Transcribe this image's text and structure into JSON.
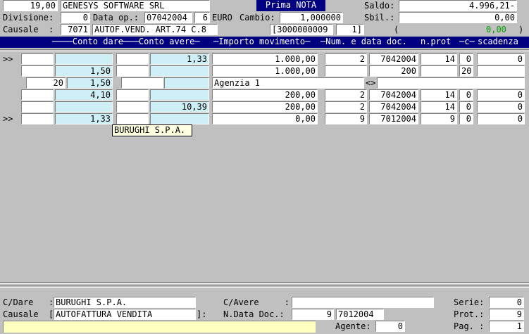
{
  "header": {
    "top_value": "19,00",
    "company": "GENESYS SOFTWARE SRL",
    "title": "Prima NOTA",
    "saldo_label": "Saldo:",
    "saldo_value": "4.996,21-",
    "divisione_label": "Divisione:",
    "divisione_value": "0",
    "data_op_label": "Data op.:",
    "data_op_value": "07042004",
    "data_op_extra": "6",
    "euro_label": "EURO",
    "cambio_label": "Cambio:",
    "cambio_value": "1,000000",
    "sbil_label": "Sbil.:",
    "sbil_value": "0,00",
    "causale_label": "Causale  :",
    "causale_code": "7071",
    "causale_desc": "AUTOF.VEND. ART.74 C.8",
    "doc_number": "[3000000009",
    "doc_extra": "1]",
    "paren_open": "(",
    "green_value": "0,00",
    "paren_close": ")"
  },
  "columns": {
    "conto_dare": "Conto dare",
    "conto_avere": "Conto avere",
    "importo": "Importo movimento",
    "num_data": "Num. e data doc.",
    "n_prot": "n.prot",
    "c": "c",
    "scadenza": "scadenza"
  },
  "rows": [
    {
      "marker": ">>",
      "dare_code": "",
      "dare_val": "",
      "avere_code": "",
      "avere_val": "1,33",
      "importo": "1.000,00",
      "num": "2",
      "data": "7042004",
      "prot": "14",
      "c": "0",
      "scad": "0"
    },
    {
      "marker": "",
      "dare_code": "",
      "dare_val": "1,50",
      "avere_code": "",
      "avere_val": "",
      "importo": "1.000,00",
      "num": "",
      "data": "200",
      "prot": "",
      "c": "20",
      "scad": ""
    },
    {
      "marker": "",
      "dare_code": "20",
      "dare_val": "1,50",
      "avere_code": "",
      "avere_val": "",
      "importo": "Agenzia 1",
      "num": "<>",
      "data": "",
      "prot": "",
      "c": "",
      "scad": ""
    },
    {
      "marker": "",
      "dare_code": "",
      "dare_val": "4,10",
      "avere_code": "",
      "avere_val": "",
      "importo": "200,00",
      "num": "2",
      "data": "7042004",
      "prot": "14",
      "c": "0",
      "scad": "0"
    },
    {
      "marker": "",
      "dare_code": "",
      "dare_val": "",
      "avere_code": "",
      "avere_val": "10,39",
      "importo": "200,00",
      "num": "2",
      "data": "7042004",
      "prot": "14",
      "c": "0",
      "scad": "0"
    },
    {
      "marker": ">>",
      "dare_code": "",
      "dare_val": "1,33",
      "avere_code": "",
      "avere_val": "",
      "importo": "0,00",
      "num": "9",
      "data": "7012004",
      "prot": "9",
      "c": "0",
      "scad": "0"
    }
  ],
  "tooltip": "BURUGHI S.P.A.",
  "footer": {
    "cdare_label": "C/Dare   :",
    "cdare_value": "BURUGHI S.P.A.",
    "cavere_label": "C/Avere     :",
    "cavere_value": "",
    "serie_label": "Serie:",
    "serie_value": "0",
    "causale_label": "Causale  [",
    "causale_value": "AUTOFATTURA VENDITA",
    "causale_close": "]:",
    "ndata_label": "N.Data Doc.:",
    "ndata_num": "9",
    "ndata_date": "7012004",
    "prot_label": "Prot.:",
    "prot_value": "9",
    "agente_label": "Agente:",
    "agente_value": "0",
    "pag_label": "Pag. :",
    "pag_value": "1"
  }
}
